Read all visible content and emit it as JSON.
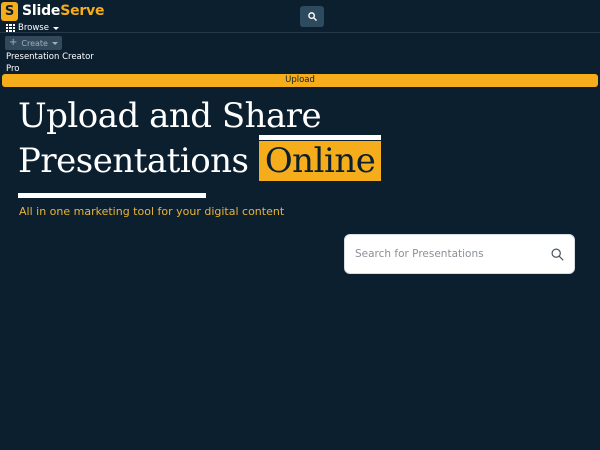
{
  "brand": {
    "mark": "S",
    "name_part1": "Slide",
    "name_part2": "Serve"
  },
  "nav": {
    "browse_label": "Browse",
    "create_label": "Create",
    "creator_pro_label": "Presentation Creator Pro",
    "upload_label": "Upload"
  },
  "hero": {
    "line1": "Upload and Share",
    "line2_prefix": "Presentations ",
    "line2_highlight": "Online",
    "tagline": "All in one marketing tool for your digital content"
  },
  "search": {
    "placeholder": "Search for Presentations",
    "value": ""
  },
  "colors": {
    "background": "#0c1f2f",
    "accent": "#f5ad1b",
    "tagline": "#e9b43b"
  },
  "icons": [
    "search-icon",
    "grid-icon",
    "plus-icon",
    "chevron-down-icon"
  ]
}
